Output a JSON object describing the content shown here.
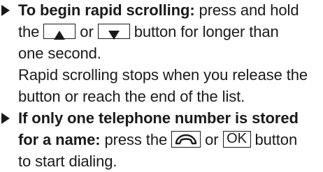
{
  "items": [
    {
      "lead": "To begin rapid scrolling:",
      "text1": " press and hold",
      "text2a": "the ",
      "key1": "up-arrow",
      "text2b": " or ",
      "key2": "down-arrow",
      "text2c": " button for longer than",
      "text3": "one second.",
      "text4": "Rapid scrolling stops when you release the",
      "text5": "button or reach the end of the list."
    },
    {
      "lead1": "If only one telephone number is stored",
      "lead2": "for a name:",
      "text2a": " press the ",
      "key1": "phone-handset",
      "text2b": " or ",
      "key2": "OK",
      "text2c": " button",
      "text3": "to start dialing."
    }
  ]
}
